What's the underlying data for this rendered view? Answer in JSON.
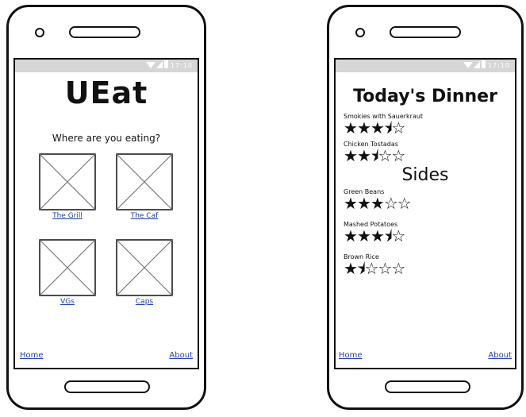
{
  "status": {
    "time": "17:10"
  },
  "phone1": {
    "title": "UEat",
    "question": "Where are you eating?",
    "locations": [
      {
        "label": "The Grill"
      },
      {
        "label": "The Caf"
      },
      {
        "label": "VGs"
      },
      {
        "label": "Caps"
      }
    ],
    "footer": {
      "home": "Home",
      "about": "About"
    }
  },
  "phone2": {
    "title": "Today's Dinner",
    "mains": [
      {
        "name": "Smokies with Sauerkraut",
        "rating": 3.5
      },
      {
        "name": "Chicken Tostadas",
        "rating": 2.5
      }
    ],
    "sides_title": "Sides",
    "sides": [
      {
        "name": "Green Beans",
        "rating": 3
      },
      {
        "name": "Mashed Potatoes",
        "rating": 3.5
      },
      {
        "name": "Brown Rice",
        "rating": 1.5
      }
    ],
    "footer": {
      "home": "Home",
      "about": "About"
    }
  }
}
